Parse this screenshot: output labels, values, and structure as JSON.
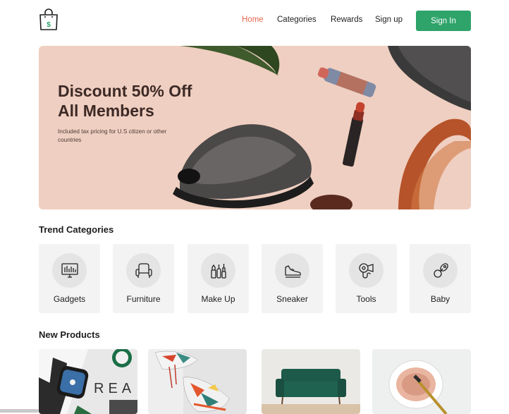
{
  "header": {
    "logo_letter": "$",
    "nav": [
      {
        "label": "Home",
        "active": true
      },
      {
        "label": "Categories",
        "active": false
      },
      {
        "label": "Rewards",
        "active": false
      },
      {
        "label": "Sign up",
        "active": false
      }
    ],
    "signin_label": "Sign In"
  },
  "hero": {
    "title_line1": "Discount 50% Off",
    "title_line2": "All Members",
    "subtitle": "Included tax pricing for U.S citizen or other countries"
  },
  "trend": {
    "title": "Trend Categories",
    "items": [
      {
        "label": "Gadgets",
        "icon": "monitor-icon"
      },
      {
        "label": "Furniture",
        "icon": "armchair-icon"
      },
      {
        "label": "Make Up",
        "icon": "makeup-icon"
      },
      {
        "label": "Sneaker",
        "icon": "sneaker-icon"
      },
      {
        "label": "Tools",
        "icon": "hairdryer-icon"
      },
      {
        "label": "Baby",
        "icon": "pacifier-icon"
      }
    ]
  },
  "new_products": {
    "title": "New Products",
    "watch_text": "REA"
  },
  "colors": {
    "accent": "#2ea36a",
    "active_nav": "#e76a4e",
    "hero_bg": "#efcfc1"
  }
}
